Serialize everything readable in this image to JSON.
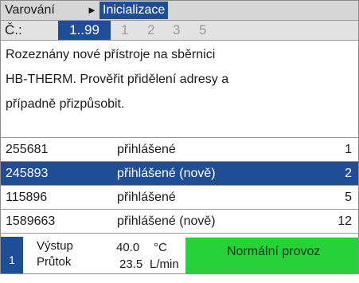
{
  "breadcrumb": {
    "home": "Varování",
    "separator": "►",
    "current": "Inicializace"
  },
  "numbar": {
    "label": "Č.:",
    "selected_range": "1..99",
    "pages": [
      "1",
      "2",
      "3",
      "5"
    ]
  },
  "message": {
    "lines": [
      "Rozeznány nové přístroje na sběrnici",
      "HB-THERM. Prověřit přidělení adresy a",
      "případně přizpůsobit."
    ]
  },
  "devices": [
    {
      "id": "255681",
      "state": "přihlášené",
      "addr": "1"
    },
    {
      "id": "245893",
      "state": "přihlášené (nově)",
      "addr": "2"
    },
    {
      "id": "115896",
      "state": "přihlášené",
      "addr": "5"
    },
    {
      "id": "1589663",
      "state": "přihlášené (nově)",
      "addr": "12"
    }
  ],
  "selected_device_index": 1,
  "status": {
    "unit": "1",
    "outlet_label": "Výstup",
    "outlet_value": "40.0",
    "outlet_unit": "°C",
    "flow_label": "Průtok",
    "flow_value": "23.5",
    "flow_unit": "L/min",
    "mode": "Normální provoz"
  },
  "colors": {
    "selection": "#1f4e96",
    "status_ok": "#27d13a",
    "inactive_page": "#9a9a9a"
  }
}
